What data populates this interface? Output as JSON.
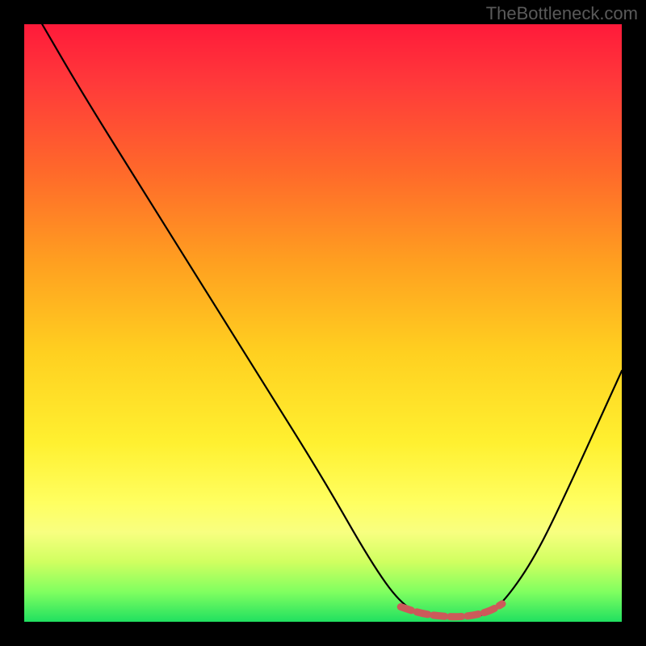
{
  "watermark": "TheBottleneck.com",
  "chart_data": {
    "type": "line",
    "title": "",
    "xlabel": "",
    "ylabel": "",
    "xlim": [
      0,
      100
    ],
    "ylim": [
      0,
      100
    ],
    "series": [
      {
        "name": "bottleneck-curve",
        "x": [
          3,
          10,
          20,
          30,
          40,
          50,
          58,
          63,
          67,
          72,
          77,
          80,
          85,
          90,
          100
        ],
        "y": [
          100,
          88,
          72,
          56,
          40,
          24,
          10,
          3,
          1,
          0.5,
          1,
          3,
          10,
          20,
          42
        ]
      },
      {
        "name": "optimal-range-marker",
        "x": [
          63,
          66,
          69,
          72,
          75,
          78,
          80
        ],
        "y": [
          2.5,
          1.5,
          1,
          0.8,
          1,
          1.8,
          3
        ]
      }
    ],
    "gradient_stops": [
      {
        "pos": 0,
        "color": "#ff1a3a"
      },
      {
        "pos": 25,
        "color": "#ff6a2a"
      },
      {
        "pos": 55,
        "color": "#ffd020"
      },
      {
        "pos": 80,
        "color": "#ffff60"
      },
      {
        "pos": 100,
        "color": "#20e060"
      }
    ]
  }
}
